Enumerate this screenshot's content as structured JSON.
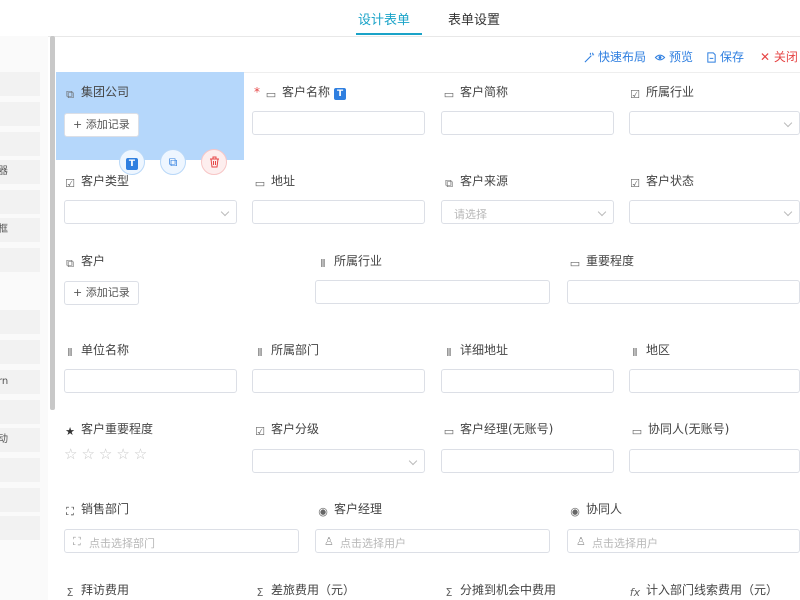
{
  "tabs": [
    {
      "label": "设计表单",
      "active": true
    },
    {
      "label": "表单设置",
      "active": false
    }
  ],
  "left_panel": {
    "items": [
      "",
      "",
      "",
      "器",
      "",
      "框",
      "",
      "",
      "",
      "rn",
      "",
      "动",
      "",
      "",
      ""
    ]
  },
  "toolbar": {
    "quick_layout": "快速布局",
    "preview": "预览",
    "save": "保存",
    "close": "关闭"
  },
  "fields": {
    "group_company": {
      "label": "集团公司",
      "button": "+ 添加记录"
    },
    "customer_name": {
      "label": "客户名称",
      "required_mark": "*"
    },
    "customer_short": {
      "label": "客户简称"
    },
    "industry_1": {
      "label": "所属行业"
    },
    "customer_type": {
      "label": "客户类型"
    },
    "address": {
      "label": "地址"
    },
    "customer_source": {
      "label": "客户来源",
      "placeholder": "请选择"
    },
    "customer_status": {
      "label": "客户状态"
    },
    "customer": {
      "label": "客户",
      "button": "+ 添加记录"
    },
    "industry_2": {
      "label": "所属行业"
    },
    "importance": {
      "label": "重要程度"
    },
    "unit_name": {
      "label": "单位名称"
    },
    "department": {
      "label": "所属部门"
    },
    "detail_address": {
      "label": "详细地址"
    },
    "region": {
      "label": "地区"
    },
    "customer_importance": {
      "label": "客户重要程度",
      "rating": 0,
      "max_rating": 5
    },
    "customer_level": {
      "label": "客户分级"
    },
    "manager_no_account": {
      "label": "客户经理(无账号)"
    },
    "collaborator_no_account": {
      "label": "协同人(无账号)"
    },
    "sales_dept": {
      "label": "销售部门",
      "placeholder": "点击选择部门"
    },
    "customer_manager": {
      "label": "客户经理",
      "placeholder": "点击选择用户"
    },
    "collaborator": {
      "label": "协同人",
      "placeholder": "点击选择用户"
    },
    "visit_cost": {
      "label": "拜访费用"
    },
    "travel_cost": {
      "label": "差旅费用（元）"
    },
    "allocated_cost": {
      "label": "分摊到机会中费用"
    },
    "dept_clue_cost": {
      "label": "计入部门线索费用（元）"
    }
  },
  "colors": {
    "accent": "#1aa3c8",
    "link": "#2f7fe0",
    "danger": "#e64545",
    "selected_bg": "#b5d7fb"
  }
}
